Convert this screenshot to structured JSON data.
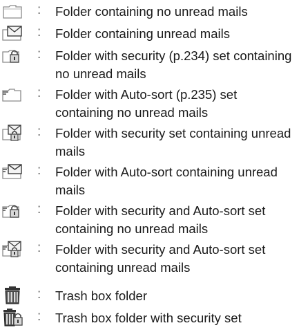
{
  "legend": {
    "items": [
      {
        "icon": "folder-icon",
        "separator": ":",
        "text": "Folder containing no unread mails"
      },
      {
        "icon": "folder-unread-mail-icon",
        "separator": ":",
        "text": "Folder containing unread mails"
      },
      {
        "icon": "folder-security-icon",
        "separator": ":",
        "text": "Folder with security (p.234) set containing no unread mails"
      },
      {
        "icon": "folder-auto-sort-icon",
        "separator": ":",
        "text": "Folder with Auto-sort (p.235) set containing no unread mails"
      },
      {
        "icon": "folder-security-unread-icon",
        "separator": ":",
        "text": "Folder with security set containing unread mails"
      },
      {
        "icon": "folder-auto-sort-unread-icon",
        "separator": ":",
        "text": "Folder with Auto-sort containing unread mails"
      },
      {
        "icon": "folder-security-auto-sort-icon",
        "separator": ":",
        "text": "Folder with security and Auto-sort set containing no unread mails"
      },
      {
        "icon": "folder-security-auto-sort-unread-icon",
        "separator": ":",
        "text": "Folder with security and Auto-sort set containing unread mails"
      },
      {
        "icon": "trash-box-icon",
        "separator": ":",
        "text": "Trash box folder"
      },
      {
        "icon": "trash-box-security-icon",
        "separator": ":",
        "text": "Trash box folder with security set"
      }
    ]
  }
}
